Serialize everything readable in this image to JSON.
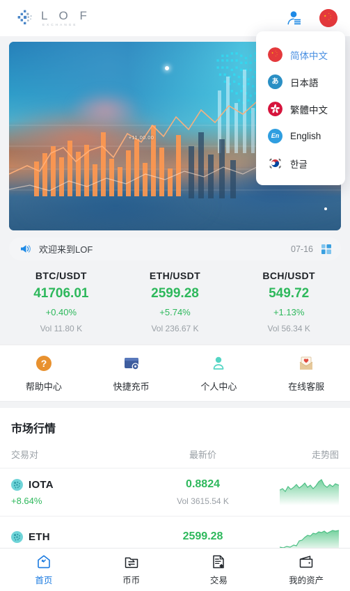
{
  "header": {
    "logo_text": "L O F",
    "logo_sub": "EXCHANGE",
    "logo_mark_icon": "dot-cluster-icon",
    "user_icon": "user-profile-icon",
    "flag_icon": "china-flag-icon"
  },
  "language_menu": {
    "items": [
      {
        "label": "简体中文",
        "flag_icon": "china-flag-icon",
        "active": true
      },
      {
        "label": "日本語",
        "flag_icon": "japan-hiragana-icon",
        "active": false
      },
      {
        "label": "繁體中文",
        "flag_icon": "hongkong-flag-icon",
        "active": false
      },
      {
        "label": "English",
        "flag_icon": "english-en-icon",
        "active": false
      },
      {
        "label": "한글",
        "flag_icon": "korea-flag-icon",
        "active": false
      }
    ]
  },
  "banner": {
    "overlay_value": "+11,00.00",
    "alt": "crypto trading world map candlestick banner"
  },
  "announcement": {
    "speaker_icon": "megaphone-icon",
    "text": "欢迎来到LOF",
    "date": "07-16",
    "grid_icon": "grid-squares-icon"
  },
  "tickers": [
    {
      "pair": "BTC/USDT",
      "price": "41706.01",
      "change": "+0.40%",
      "volume": "Vol 11.80 K"
    },
    {
      "pair": "ETH/USDT",
      "price": "2599.28",
      "change": "+5.74%",
      "volume": "Vol 236.67 K"
    },
    {
      "pair": "BCH/USDT",
      "price": "549.72",
      "change": "+1.13%",
      "volume": "Vol 56.34 K"
    }
  ],
  "quick_actions": [
    {
      "label": "帮助中心",
      "icon": "question-circle-icon"
    },
    {
      "label": "快捷充币",
      "icon": "deposit-card-icon"
    },
    {
      "label": "个人中心",
      "icon": "person-icon"
    },
    {
      "label": "在线客服",
      "icon": "envelope-heart-icon"
    }
  ],
  "market": {
    "title": "市场行情",
    "columns": {
      "pair": "交易对",
      "price": "最新价",
      "trend": "走势图"
    },
    "rows": [
      {
        "symbol": "IOTA",
        "coin_icon": "iota-coin-icon",
        "change": "+8.64%",
        "price": "0.8824",
        "volume": "Vol 3615.54 K",
        "spark": [
          20,
          22,
          19,
          24,
          21,
          23,
          26,
          22,
          25,
          28,
          24,
          27,
          23,
          26,
          30,
          35,
          28,
          26,
          29,
          27,
          30,
          28,
          29
        ]
      },
      {
        "symbol": "ETH",
        "coin_icon": "eth-coin-icon",
        "change": "",
        "price": "2599.28",
        "volume": "",
        "spark": [
          6,
          5,
          7,
          6,
          8,
          7,
          9,
          14,
          16,
          18,
          22,
          24,
          23,
          26,
          28,
          27,
          29,
          26,
          28,
          30,
          29,
          31,
          30
        ]
      }
    ]
  },
  "tabbar": [
    {
      "label": "首页",
      "icon": "home-icon",
      "active": true
    },
    {
      "label": "币币",
      "icon": "exchange-folder-icon",
      "active": false
    },
    {
      "label": "交易",
      "icon": "trade-document-icon",
      "active": false
    },
    {
      "label": "我的资产",
      "icon": "wallet-icon",
      "active": false
    }
  ],
  "colors": {
    "green": "#2eb85c",
    "accent_blue": "#1a7ae0",
    "orange": "#e8912f",
    "red": "#e4393c",
    "page_bg": "#f2f3f5"
  }
}
